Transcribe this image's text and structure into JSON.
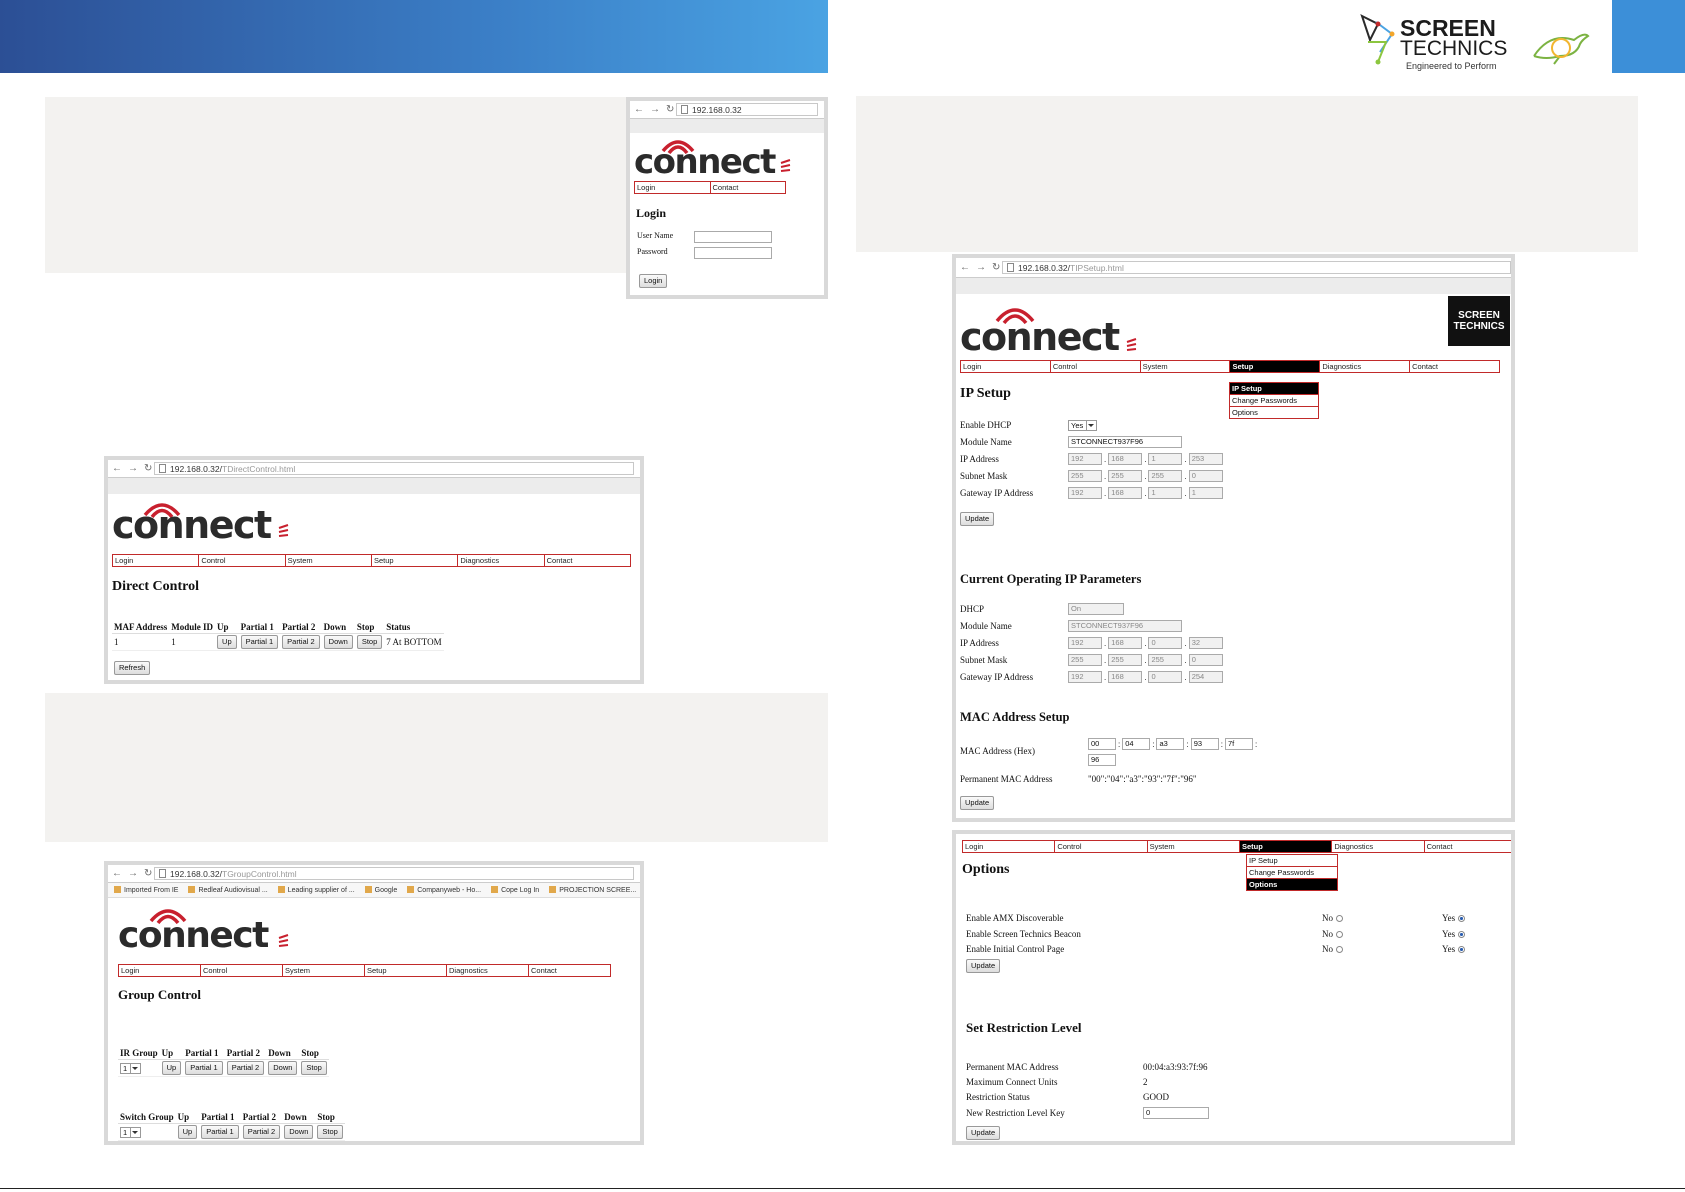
{
  "brand": {
    "name_line1": "SCREEN",
    "name_line2": "TECHNICS",
    "tagline": "Engineered to Perform",
    "primary_color": "#2c4f95",
    "accent_color": "#c12a2a"
  },
  "connect_logo": {
    "word": "connect"
  },
  "menu": [
    "Login",
    "Control",
    "System",
    "Setup",
    "Diagnostics",
    "Contact"
  ],
  "login_shot": {
    "url": "192.168.0.32",
    "menu": [
      "Login",
      "Contact"
    ],
    "title": "Login",
    "user_label": "User Name",
    "password_label": "Password",
    "button": "Login"
  },
  "direct_shot": {
    "url_host": "192.168.0.32/",
    "url_path": "TDirectControl.html",
    "title": "Direct Control",
    "headers": [
      "MAF Address",
      "Module ID",
      "Up",
      "Partial 1",
      "Partial 2",
      "Down",
      "Stop",
      "Status"
    ],
    "row": {
      "maf": "1",
      "module": "1",
      "up": "Up",
      "p1": "Partial 1",
      "p2": "Partial 2",
      "down": "Down",
      "stop": "Stop",
      "status": "7 At BOTTOM"
    },
    "refresh": "Refresh"
  },
  "group_shot": {
    "url_host": "192.168.0.32/",
    "url_path": "TGroupControl.html",
    "bookmarks": [
      "Imported From IE",
      "Redleaf Audiovisual ...",
      "Leading supplier of ...",
      "Google",
      "Companyweb - Ho...",
      "Cope Log In",
      "PROJECTION SCREE..."
    ],
    "title": "Group Control",
    "ir_headers": [
      "IR Group",
      "Up",
      "Partial 1",
      "Partial 2",
      "Down",
      "Stop"
    ],
    "switch_headers": [
      "Switch Group",
      "Up",
      "Partial 1",
      "Partial 2",
      "Down",
      "Stop"
    ],
    "group_value": "1",
    "buttons": {
      "up": "Up",
      "p1": "Partial 1",
      "p2": "Partial 2",
      "down": "Down",
      "stop": "Stop"
    }
  },
  "ip_shot": {
    "url_host": "192.168.0.32/",
    "url_path": "TIPSetup.html",
    "badge_line1": "SCREEN",
    "badge_line2": "TECHNICS",
    "dropdown": [
      "IP Setup",
      "Change Passwords",
      "Options"
    ],
    "title": "IP Setup",
    "dhcp_label": "Enable DHCP",
    "dhcp_value": "Yes",
    "module_label": "Module Name",
    "module_value": "STCONNECT937F96",
    "ip_label": "IP Address",
    "ip": [
      "192",
      "168",
      "1",
      "253"
    ],
    "mask_label": "Subnet Mask",
    "mask": [
      "255",
      "255",
      "255",
      "0"
    ],
    "gw_label": "Gateway IP Address",
    "gw": [
      "192",
      "168",
      "1",
      "1"
    ],
    "update": "Update",
    "current_title": "Current Operating IP Parameters",
    "cur_dhcp_label": "DHCP",
    "cur_dhcp_value": "On",
    "cur_module_value": "STCONNECT937F96",
    "cur_ip": [
      "192",
      "168",
      "0",
      "32"
    ],
    "cur_mask": [
      "255",
      "255",
      "255",
      "0"
    ],
    "cur_gw": [
      "192",
      "168",
      "0",
      "254"
    ],
    "mac_title": "MAC Address Setup",
    "mac_label": "MAC Address (Hex)",
    "mac": [
      "00",
      "04",
      "a3",
      "93",
      "7f",
      "96"
    ],
    "perm_label": "Permanent MAC Address",
    "perm_value": "\"00\":\"04\":\"a3\":\"93\":\"7f\":\"96\""
  },
  "options_shot": {
    "dropdown": [
      "IP Setup",
      "Change Passwords",
      "Options"
    ],
    "title": "Options",
    "no": "No",
    "yes": "Yes",
    "opt_amx": "Enable AMX Discoverable",
    "opt_beacon": "Enable Screen Technics Beacon",
    "opt_initial": "Enable Initial Control Page",
    "update": "Update",
    "restrict_title": "Set Restriction Level",
    "perm_label": "Permanent MAC Address",
    "perm_value": "00:04:a3:93:7f:96",
    "max_label": "Maximum Connect Units",
    "max_value": "2",
    "status_label": "Restriction Status",
    "status_value": "GOOD",
    "key_label": "New Restriction Level Key",
    "key_value": "0"
  }
}
